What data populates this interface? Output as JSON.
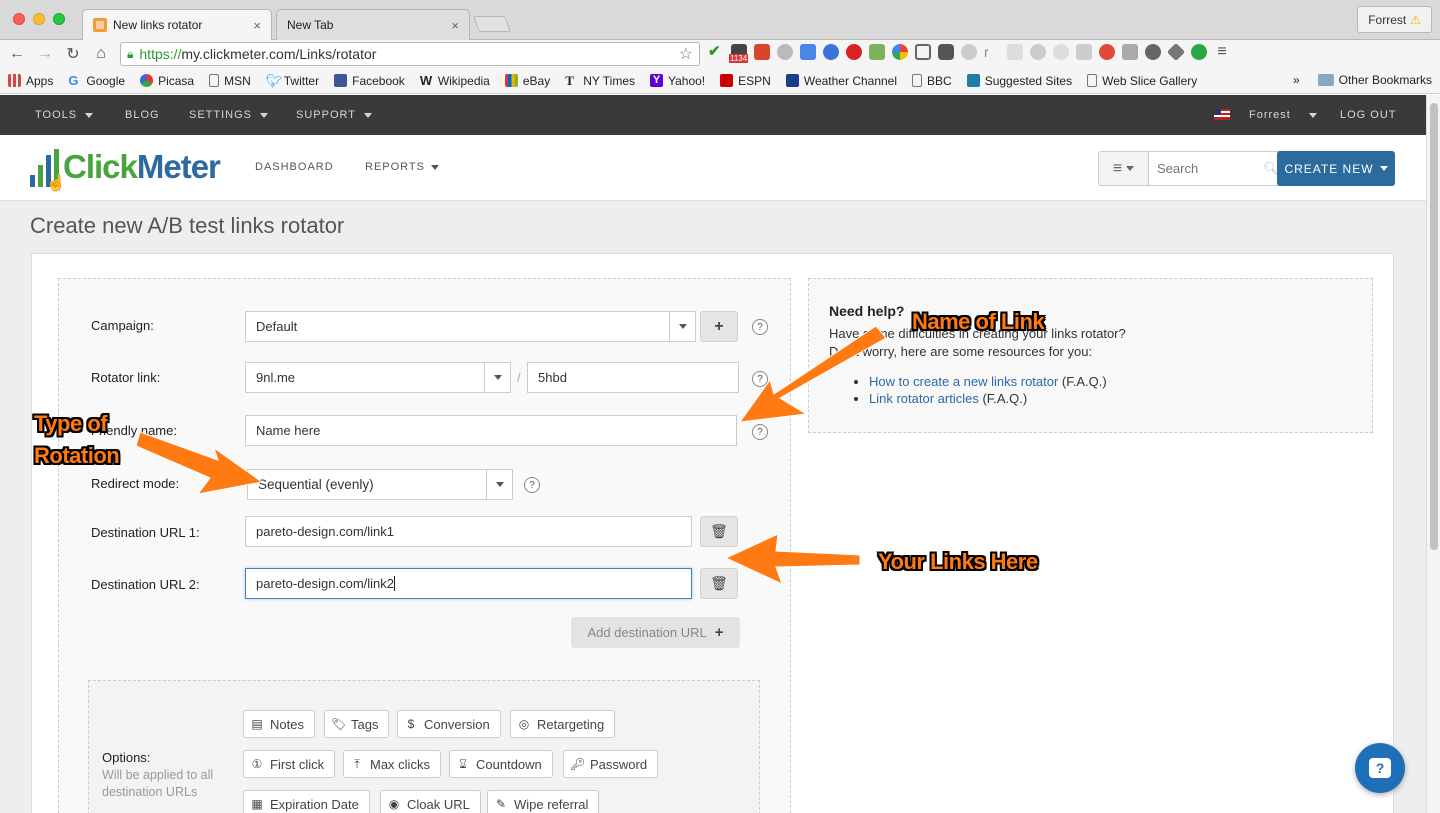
{
  "browser": {
    "tabs": [
      {
        "title": "New links rotator",
        "close": "×"
      },
      {
        "title": "New Tab",
        "close": "×"
      }
    ],
    "profile": "Forrest",
    "url_scheme": "https://",
    "url_rest": "my.clickmeter.com/Links/rotator",
    "extension_badge": "1134",
    "bookmarks": [
      "Apps",
      "Google",
      "Picasa",
      "MSN",
      "Twitter",
      "Facebook",
      "Wikipedia",
      "eBay",
      "NY Times",
      "Yahoo!",
      "ESPN",
      "Weather Channel",
      "BBC",
      "Suggested Sites",
      "Web Slice Gallery"
    ],
    "bookmarks_overflow": "»",
    "other_bookmarks": "Other Bookmarks"
  },
  "appbar": {
    "tools": "TOOLS",
    "blog": "BLOG",
    "settings": "SETTINGS",
    "support": "SUPPORT",
    "user": "Forrest",
    "logout": "LOG OUT"
  },
  "header": {
    "logo_part1": "Click",
    "logo_part2": "Meter",
    "dashboard": "DASHBOARD",
    "reports": "REPORTS",
    "search_placeholder": "Search",
    "create_new": "CREATE NEW"
  },
  "page": {
    "title": "Create new A/B test links rotator"
  },
  "form": {
    "campaign_label": "Campaign:",
    "campaign_value": "Default",
    "rotator_label": "Rotator link:",
    "rotator_domain": "9nl.me",
    "rotator_separator": "/",
    "rotator_code": "5hbd",
    "friendly_label": "Friendly name:",
    "friendly_value": "Name here",
    "redirect_label": "Redirect mode:",
    "redirect_value": "Sequential (evenly)",
    "dest1_label": "Destination URL  1:",
    "dest1_value": "pareto-design.com/link1",
    "dest2_label": "Destination URL  2:",
    "dest2_value": "pareto-design.com/link2",
    "add_destination": "Add destination URL",
    "help_mark": "?",
    "options_label": "Options:",
    "options_sub": "Will be applied to all destination URLs",
    "options": [
      "Notes",
      "Tags",
      "Conversion",
      "Retargeting",
      "First click",
      "Max clicks",
      "Countdown",
      "Password",
      "Expiration Date",
      "Cloak URL",
      "Wipe referral"
    ]
  },
  "help": {
    "title": "Need help?",
    "line1": "Have some difficulties in creating your links rotator?",
    "line2": "Don't worry, here are some resources for you:",
    "link1": "How to create a new links rotator",
    "link1_suffix": " (F.A.Q.)",
    "link2": "Link rotator articles",
    "link2_suffix": " (F.A.Q.)"
  },
  "annotations": {
    "name_of_link": "Name of Link",
    "type_line1": "Type of",
    "type_line2": "Rotation",
    "your_links": "Your Links Here"
  },
  "colors": {
    "accent": "#2b6b9e",
    "arrow": "#ff7a12",
    "logo_green": "#4aa43e",
    "logo_blue": "#2c6aa0"
  }
}
